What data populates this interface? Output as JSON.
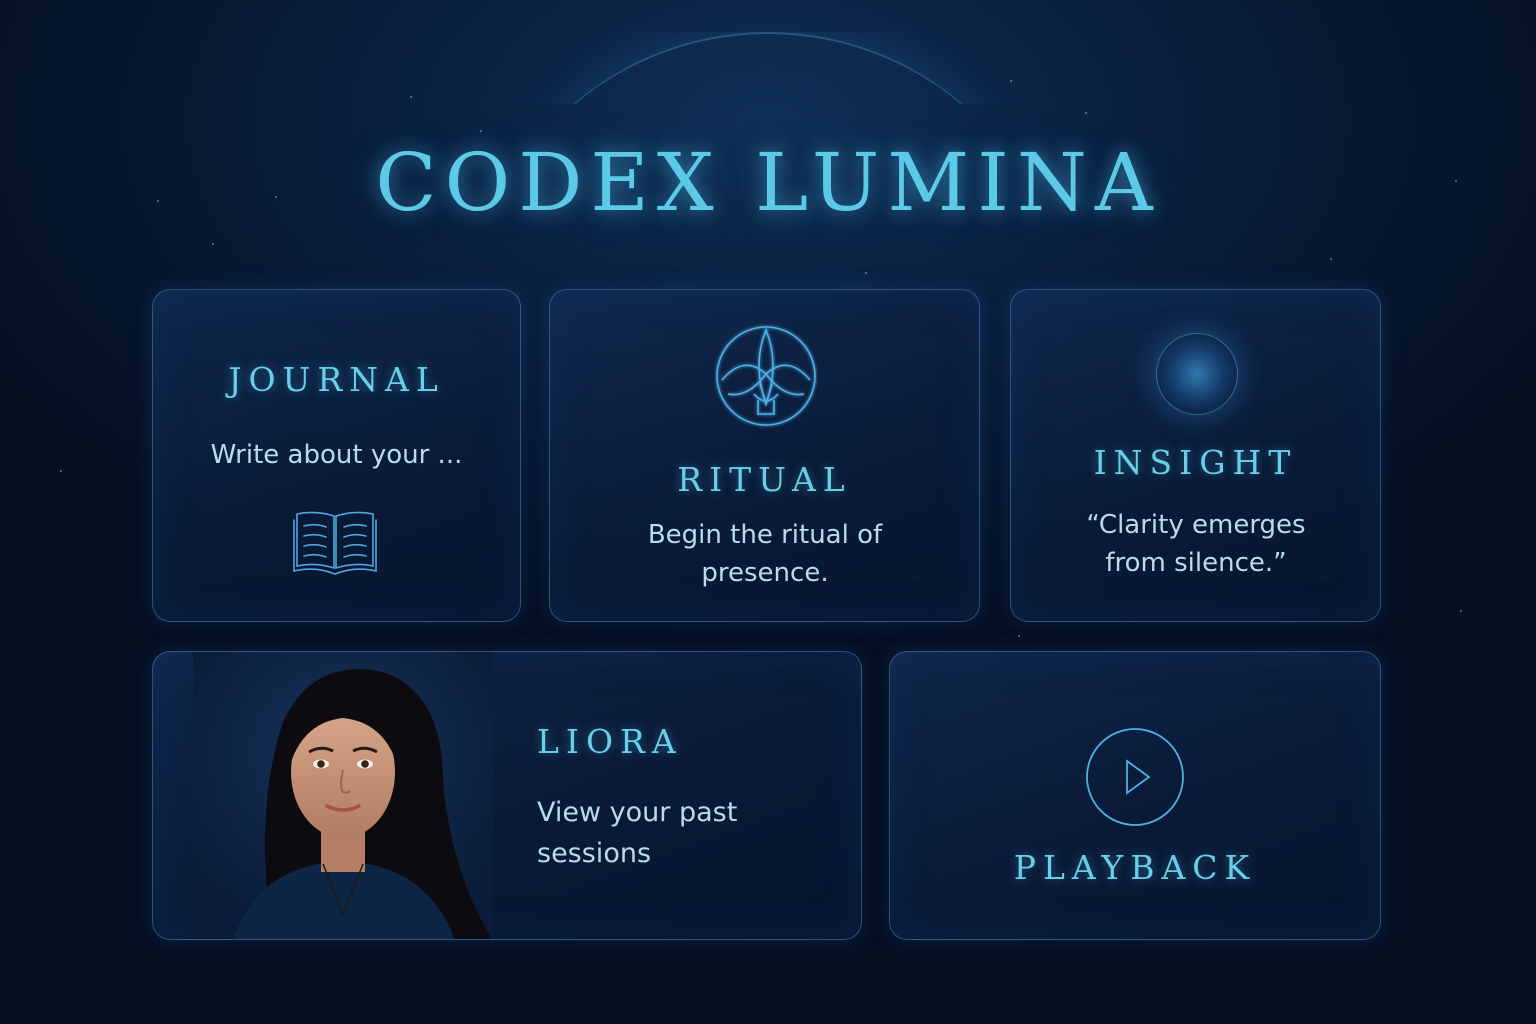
{
  "app": {
    "title": "CODEX LUMINA"
  },
  "cards": {
    "journal": {
      "title": "JOURNAL",
      "text": "Write about your ...",
      "icon": "open-book-icon"
    },
    "ritual": {
      "title": "RITUAL",
      "text": "Begin the ritual of presence.",
      "icon": "lotus-emblem-icon"
    },
    "insight": {
      "title": "INSIGHT",
      "text": "“Clarity emerges from silence.”",
      "icon": "glowing-orb-icon"
    },
    "liora": {
      "title": "LIORA",
      "text": "View your past sessions"
    },
    "playback": {
      "title": "PLAYBACK",
      "icon": "play-icon"
    }
  },
  "colors": {
    "accent": "#5cc9e6",
    "background": "#07142a",
    "card_border": "#4a7fb0",
    "text": "#b8dcec"
  }
}
